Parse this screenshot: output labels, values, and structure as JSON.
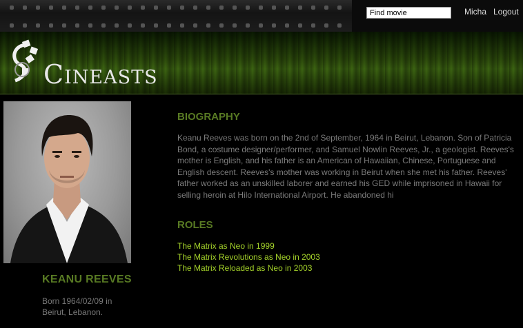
{
  "header": {
    "search": {
      "value": "Find movie"
    },
    "user_link": "Micha",
    "logout_link": "Logout",
    "logo_text": "Cineasts"
  },
  "person": {
    "name": "KEANU REEVES",
    "born": "Born 1964/02/09 in Beirut, Lebanon."
  },
  "biography": {
    "heading": "BIOGRAPHY",
    "text": "Keanu Reeves was born on the 2nd of September, 1964 in Beirut, Lebanon. Son of Patricia Bond, a costume designer/performer, and Samuel Nowlin Reeves, Jr., a geologist. Reeves's mother is English, and his father is an American of Hawaiian, Chinese, Portuguese and English descent. Reeves's mother was working in Beirut when she met his father. Reeves' father worked as an unskilled laborer and earned his GED while imprisoned in Hawaii for selling heroin at Hilo International Airport. He abandoned hi"
  },
  "roles": {
    "heading": "ROLES",
    "items": [
      "The Matrix as Neo in 1999",
      "The Matrix Revolutions as Neo in 2003",
      "The Matrix Reloaded as Neo in 2003"
    ]
  },
  "colors": {
    "accent_green": "#587a23",
    "link_green": "#a4d22a",
    "body_text": "#7a7a7a"
  }
}
